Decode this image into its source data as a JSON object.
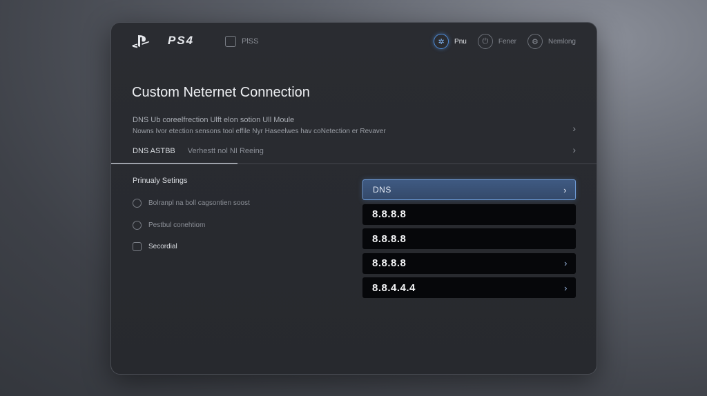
{
  "topbar": {
    "brand_text": "PS4",
    "store_label": "PlSS",
    "nav": [
      {
        "label": "Pnu",
        "icon": "network-icon"
      },
      {
        "label": "Fener",
        "icon": "power-icon"
      },
      {
        "label": "Nemlong",
        "icon": "settings-icon"
      }
    ]
  },
  "page": {
    "title": "Custom Neternet Connection",
    "desc_line1": "DNS Ub  coreelfrection Ulft elon sotion Ull Moule",
    "desc_line2": "Nowns Ivor etection sensons tool effile Nyr Haseelwes hav coNetection er Revaver",
    "row3_a": "DNS  ASTBB",
    "row3_b": "Verhestt nol NI Reeing"
  },
  "settings": {
    "section_title": "Prinualy Setings",
    "options": [
      {
        "label": "Bolranpl na boll cagsontien soost"
      },
      {
        "label": "Pestbul conehtiom"
      },
      {
        "label": "Secordial"
      }
    ]
  },
  "dns": {
    "header": "DNS",
    "entries": [
      "8.8.8.8",
      "8.8.8.8",
      "8.8.8.8",
      "8.8.4.4.4"
    ]
  },
  "colors": {
    "accent": "#4f8bd6",
    "panel": "#2a2c31",
    "field": "#06070a"
  }
}
